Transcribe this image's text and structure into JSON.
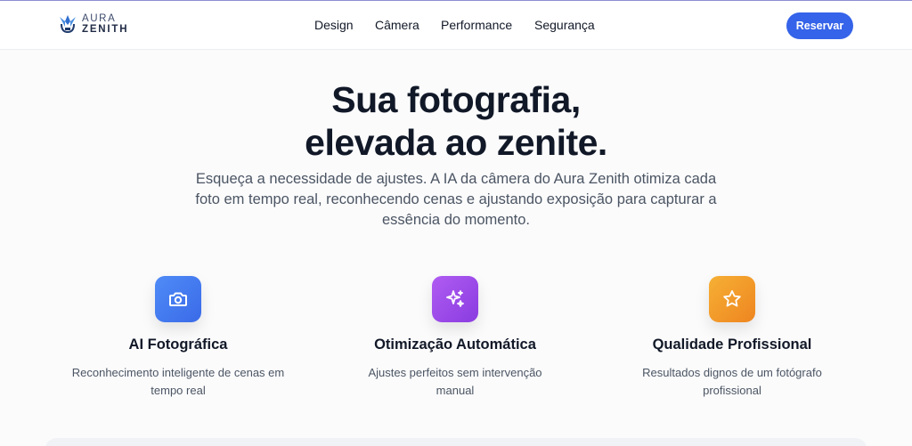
{
  "brand": {
    "line1": "AURA",
    "line2": "ZENITH"
  },
  "nav": [
    "Design",
    "Câmera",
    "Performance",
    "Segurança"
  ],
  "cta": "Reservar",
  "hero": {
    "title_line1": "Sua fotografia,",
    "title_line2": "elevada ao zenite.",
    "subtitle": "Esqueça a necessidade de ajustes. A IA da câmera do Aura Zenith otimiza cada foto em tempo real, reconhecendo cenas e ajustando exposição para capturar a essência do momento."
  },
  "features": [
    {
      "icon": "camera-icon",
      "title": "AI Fotográfica",
      "description": "Reconhecimento inteligente de cenas em tempo real",
      "color": "#3f74ee"
    },
    {
      "icon": "sparkles-icon",
      "title": "Otimização Automática",
      "description": "Ajustes perfeitos sem intervenção manual",
      "color": "#9a48e8"
    },
    {
      "icon": "star-icon",
      "title": "Qualidade Profissional",
      "description": "Resultados dignos de um fotógrafo profissional",
      "color": "#f29a2a"
    }
  ]
}
